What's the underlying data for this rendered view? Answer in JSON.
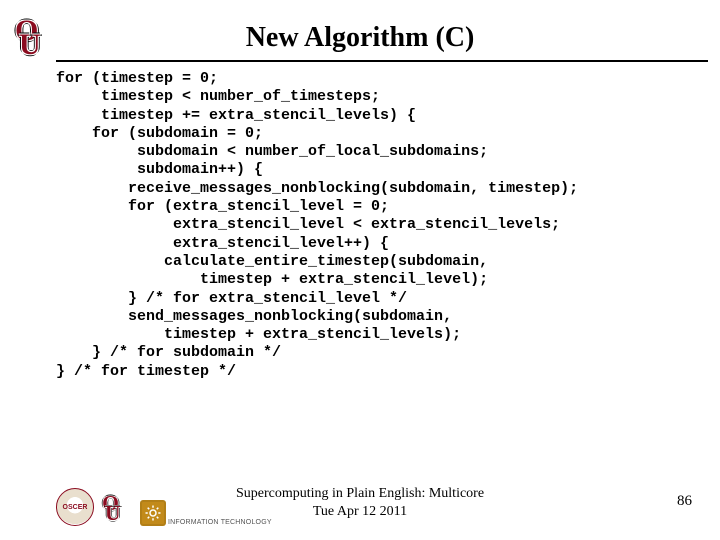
{
  "title": "New Algorithm (C)",
  "code_lines": [
    "for (timestep = 0;",
    "     timestep < number_of_timesteps;",
    "     timestep += extra_stencil_levels) {",
    "    for (subdomain = 0;",
    "         subdomain < number_of_local_subdomains;",
    "         subdomain++) {",
    "        receive_messages_nonblocking(subdomain, timestep);",
    "        for (extra_stencil_level = 0;",
    "             extra_stencil_level < extra_stencil_levels;",
    "             extra_stencil_level++) {",
    "            calculate_entire_timestep(subdomain,",
    "                timestep + extra_stencil_level);",
    "        } /* for extra_stencil_level */",
    "        send_messages_nonblocking(subdomain,",
    "            timestep + extra_stencil_levels);",
    "    } /* for subdomain */",
    "} /* for timestep */"
  ],
  "footer": {
    "line1": "Supercomputing in Plain English: Multicore",
    "line2": "Tue Apr 12 2011"
  },
  "page_number": "86",
  "logos": {
    "top_left": "ou-logo",
    "bottom": [
      "oscer-badge",
      "ou-logo",
      "it-logo"
    ]
  },
  "it_label": "INFORMATION\nTECHNOLOGY",
  "oscer_label": "OSCER"
}
